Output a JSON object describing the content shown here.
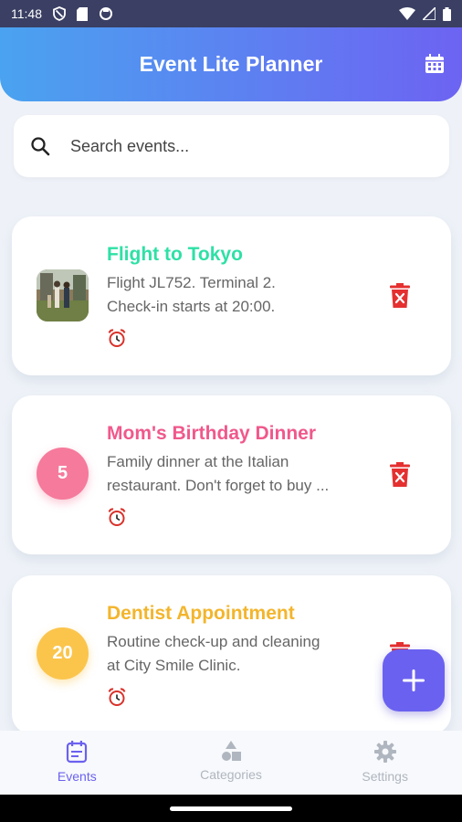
{
  "status_bar": {
    "time": "11:48"
  },
  "app_bar": {
    "title": "Event Lite Planner"
  },
  "search": {
    "placeholder": "Search events..."
  },
  "events": [
    {
      "title": "Flight to Tokyo",
      "line1": "Flight JL752. Terminal 2.",
      "line2": "Check-in starts at 20:00.",
      "title_color": "#2ee0a6"
    },
    {
      "title": "Mom's Birthday Dinner",
      "badge": "5",
      "line1": "Family dinner at the Italian",
      "line2": "restaurant. Don't forget to buy ...",
      "title_color": "#f0588c",
      "badge_color": "#f57a9b"
    },
    {
      "title": "Dentist Appointment",
      "badge": "20",
      "line1": "Routine check-up and cleaning",
      "line2": "at City Smile Clinic.",
      "title_color": "#f3b52c",
      "badge_color": "#fbc54c"
    }
  ],
  "nav": {
    "events": "Events",
    "categories": "Categories",
    "settings": "Settings",
    "active_color": "#6b61f0",
    "inactive_color": "#b0b6bf"
  }
}
